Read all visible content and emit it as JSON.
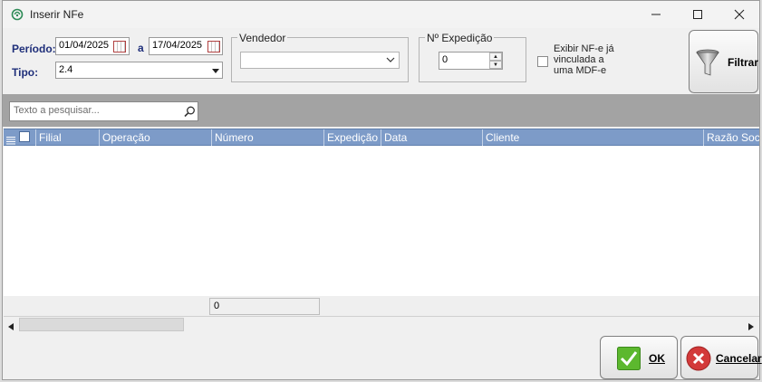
{
  "window": {
    "title": "Inserir NFe"
  },
  "filters": {
    "periodo_label": "Período:",
    "date_from": "01/04/2025",
    "date_sep": "a",
    "date_to": "17/04/2025",
    "tipo_label": "Tipo:",
    "tipo_value": "2.4",
    "vendedor_label": "Vendedor",
    "vendedor_value": "",
    "expedicao_label": "Nº Expedição",
    "expedicao_value": "0",
    "exibir_label_1": "Exibir NF-e já",
    "exibir_label_2": "vinculada a",
    "exibir_label_3": "uma MDF-e",
    "filtrar_label": "Filtrar"
  },
  "search": {
    "placeholder": "Texto a pesquisar..."
  },
  "grid": {
    "columns": [
      "Filial",
      "Operação",
      "Número",
      "Expedição",
      "Data",
      "Cliente",
      "Razão Social"
    ],
    "count": "0"
  },
  "actions": {
    "ok_label": "OK",
    "cancel_label": "Cancelar"
  },
  "colors": {
    "header_blue": "#7d9bc8",
    "label_blue": "#1f2f7a",
    "ok_green": "#5cb82e",
    "cancel_red": "#d33a3a"
  }
}
